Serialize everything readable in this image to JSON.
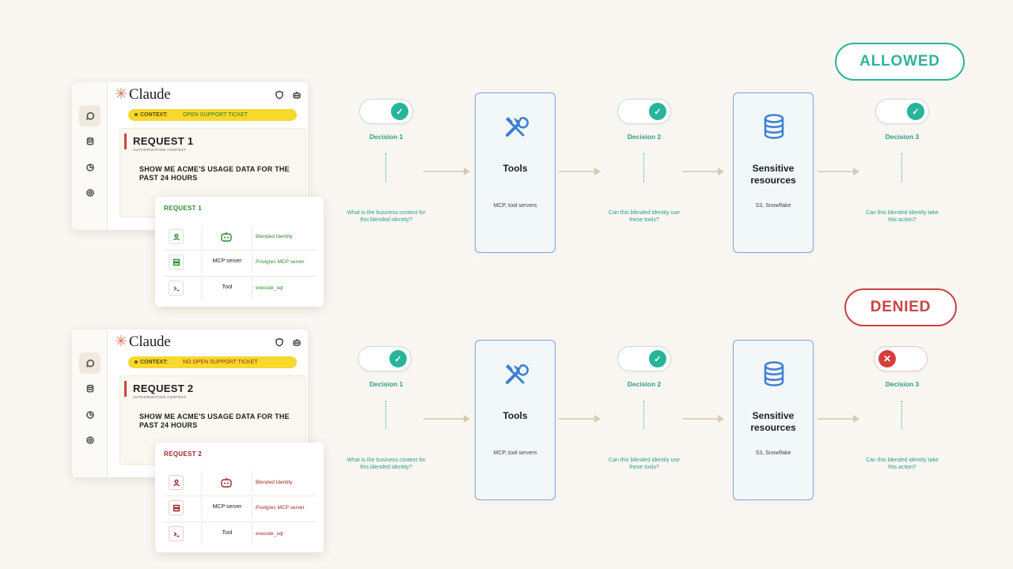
{
  "app": {
    "brand": "Claude"
  },
  "rows": [
    {
      "request_title": "REQUEST 1",
      "context_label": "CONTEXT:",
      "context_value": "OPEN SUPPORT TICKET",
      "auth_label": "AUTHORIZATION CONTEXT",
      "request_text": "SHOW ME ACME'S USAGE DATA FOR THE PAST 24 HOURS",
      "detail_title": "REQUEST 1",
      "identity_rows": [
        {
          "mid": "",
          "value": "Blended Identity"
        },
        {
          "mid": "MCP server",
          "value": "Postgres MCP server"
        },
        {
          "mid": "Tool",
          "value": "execute_sql"
        }
      ],
      "decisions": [
        {
          "label": "Decision 1",
          "question": "What is the business context for this blended identity?",
          "state": "on"
        },
        {
          "label": "Decision 2",
          "question": "Can this blended identity use these tools?",
          "state": "on"
        },
        {
          "label": "Decision 3",
          "question": "Can this blended identity take this action?",
          "state": "on"
        }
      ],
      "tools": {
        "title": "Tools",
        "subtitle": "MCP, tool servers"
      },
      "sensitive": {
        "title": "Sensitive resources",
        "subtitle": "S3, Snowflake"
      },
      "outcome": "ALLOWED"
    },
    {
      "request_title": "REQUEST 2",
      "context_label": "CONTEXT:",
      "context_value": "NO OPEN SUPPORT TICKET",
      "auth_label": "AUTHORIZATION CONTEXT",
      "request_text": "SHOW ME ACME'S USAGE DATA FOR THE PAST 24 HOURS",
      "detail_title": "REQUEST 2",
      "identity_rows": [
        {
          "mid": "",
          "value": "Blended Identity"
        },
        {
          "mid": "MCP server",
          "value": "Postgres MCP server"
        },
        {
          "mid": "Tool",
          "value": "execute_sql"
        }
      ],
      "decisions": [
        {
          "label": "Decision 1",
          "question": "What is the business context for this blended identity?",
          "state": "on"
        },
        {
          "label": "Decision 2",
          "question": "Can this blended identity use these tools?",
          "state": "on"
        },
        {
          "label": "Decision 3",
          "question": "Can this blended identity take this action?",
          "state": "off"
        }
      ],
      "tools": {
        "title": "Tools",
        "subtitle": "MCP, tool servers"
      },
      "sensitive": {
        "title": "Sensitive resources",
        "subtitle": "S3, Snowflake"
      },
      "outcome": "DENIED"
    }
  ],
  "colors": {
    "allowed": "#2fb39a",
    "denied": "#c94343",
    "context_bar": "#f7d82b",
    "brand_accent": "#d97757",
    "resource_border": "#7da6e0"
  },
  "icons": {
    "check": "✓",
    "cross": "✕",
    "star": "✳"
  }
}
